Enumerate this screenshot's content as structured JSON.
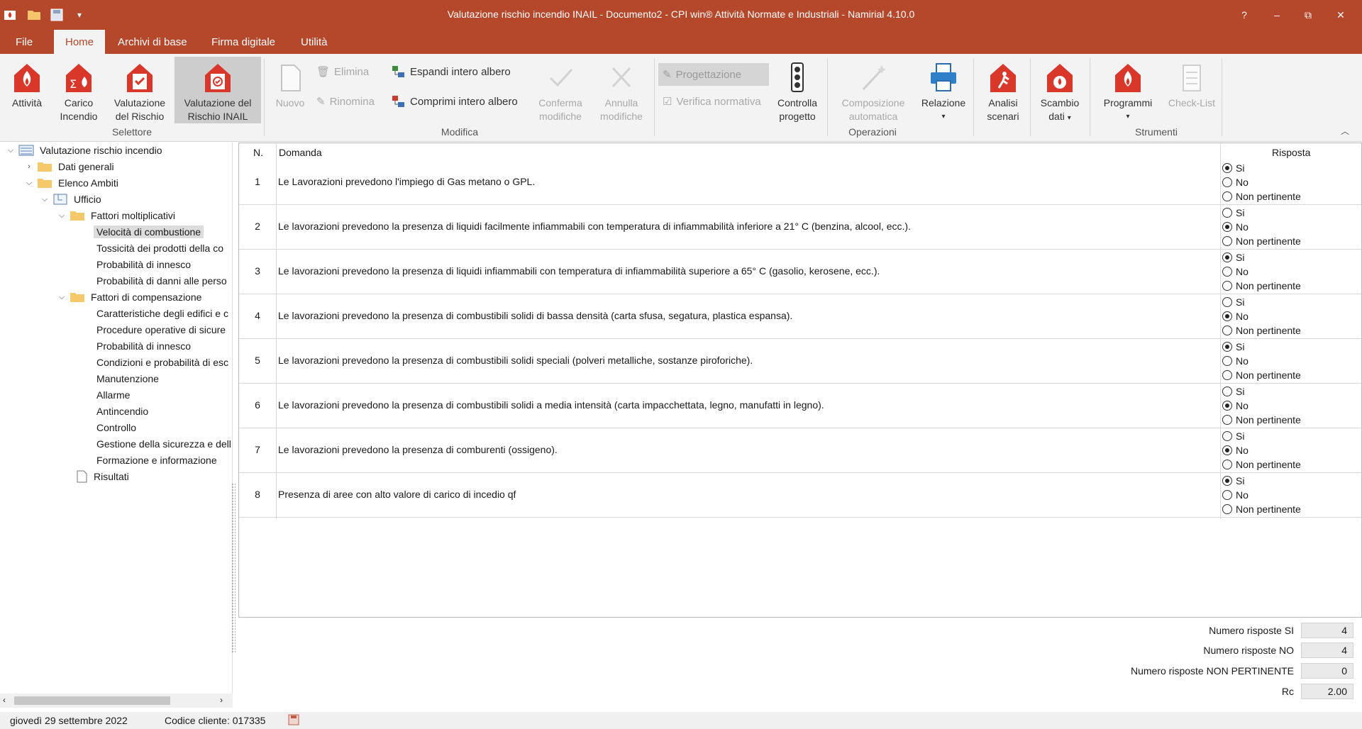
{
  "window": {
    "title": "Valutazione rischio incendio INAIL - Documento2 - CPI win® Attività  Normate e Industriali - Namirial 4.10.0",
    "help": "?",
    "minimize": "–",
    "restore": "⧉",
    "close": "✕"
  },
  "colors": {
    "brand": "#b5472b",
    "icon_red": "#d9372a"
  },
  "tabs": [
    "File",
    "Home",
    "Archivi di base",
    "Firma digitale",
    "Utilità"
  ],
  "ribbon": {
    "selettore": {
      "group": "Selettore",
      "attivita": "Attività",
      "carico_1": "Carico",
      "carico_2": "Incendio",
      "valrischio_1": "Valutazione",
      "valrischio_2": "del Rischio",
      "valinail_1": "Valutazione del",
      "valinail_2": "Rischio INAIL"
    },
    "modifica": {
      "group": "Modifica",
      "nuovo": "Nuovo",
      "elimina": "Elimina",
      "rinomina": "Rinomina",
      "espandi": "Espandi intero albero",
      "comprimi": "Comprimi intero albero",
      "conferma_1": "Conferma",
      "conferma_2": "modifiche",
      "annulla_1": "Annulla",
      "annulla_2": "modifiche"
    },
    "operazioni": {
      "group": "Operazioni",
      "progettazione": "Progettazione",
      "verifica": "Verifica normativa",
      "controlla_1": "Controlla",
      "controlla_2": "progetto",
      "composizione_1": "Composizione",
      "composizione_2": "automatica",
      "relazione": "Relazione",
      "analisi_1": "Analisi",
      "analisi_2": "scenari",
      "scambio_1": "Scambio",
      "scambio_2": "dati"
    },
    "strumenti": {
      "group": "Strumenti",
      "programmi": "Programmi",
      "checklist": "Check-List"
    }
  },
  "tree": {
    "root": "Valutazione rischio incendio",
    "dati_generali": "Dati generali",
    "elenco_ambiti": "Elenco Ambiti",
    "ufficio": "Ufficio",
    "fattori_molt": "Fattori moltiplicativi",
    "molt_items": [
      "Velocità di combustione",
      "Tossicità dei prodotti della co",
      "Probabilità di innesco",
      "Probabilità di danni alle perso"
    ],
    "fattori_comp": "Fattori di compensazione",
    "comp_items": [
      "Caratteristiche degli edifici e c",
      "Procedure operative di sicure",
      "Probabilità di innesco",
      "Condizioni e probabilità di esc",
      "Manutenzione",
      "Allarme",
      "Antincendio",
      "Controllo",
      "Gestione della sicurezza e dell",
      "Formazione e informazione"
    ],
    "risultati": "Risultati"
  },
  "table": {
    "col_num": "N.",
    "col_domanda": "Domanda",
    "col_risposta": "Risposta",
    "options": [
      "Si",
      "No",
      "Non pertinente"
    ],
    "rows": [
      {
        "n": "1",
        "text": "Le Lavorazioni prevedono l'impiego di Gas metano o GPL.",
        "answer": "Si"
      },
      {
        "n": "2",
        "text": "Le lavorazioni prevedono la presenza di liquidi facilmente infiammabili con temperatura di infiammabilità inferiore a 21° C (benzina, alcool, ecc.).",
        "answer": "No"
      },
      {
        "n": "3",
        "text": "Le lavorazioni prevedono la presenza di liquidi infiammabili con temperatura di infiammabilità superiore a 65° C (gasolio, kerosene, ecc.).",
        "answer": "Si"
      },
      {
        "n": "4",
        "text": "Le lavorazioni prevedono la presenza di combustibili solidi di bassa densità (carta sfusa, segatura, plastica espansa).",
        "answer": "No"
      },
      {
        "n": "5",
        "text": "Le lavorazioni prevedono la presenza di combustibili solidi speciali (polveri metalliche, sostanze piroforiche).",
        "answer": "Si"
      },
      {
        "n": "6",
        "text": "Le lavorazioni prevedono la presenza di combustibili solidi a media intensità (carta impacchettata, legno, manufatti in legno).",
        "answer": "No"
      },
      {
        "n": "7",
        "text": "Le lavorazioni prevedono la presenza di comburenti (ossigeno).",
        "answer": "No"
      },
      {
        "n": "8",
        "text": "Presenza di aree con alto valore di carico di incedio qf",
        "answer": "Si"
      }
    ]
  },
  "totals": {
    "si_label": "Numero risposte SI",
    "si_value": "4",
    "no_label": "Numero risposte NO",
    "no_value": "4",
    "np_label": "Numero risposte NON PERTINENTE",
    "np_value": "0",
    "rc_label": "Rc",
    "rc_value": "2.00"
  },
  "status": {
    "date": "giovedì 29 settembre 2022",
    "client": "Codice cliente: 017335"
  }
}
